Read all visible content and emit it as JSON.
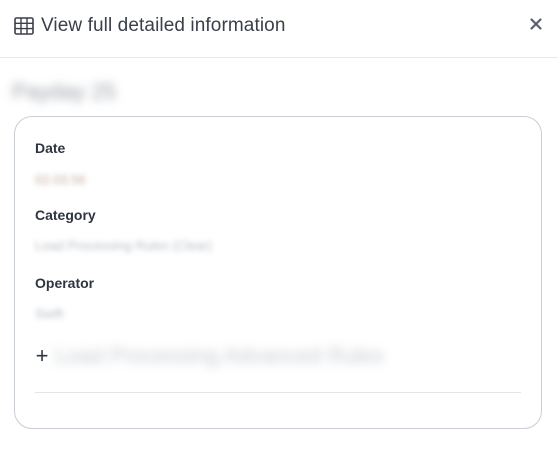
{
  "dialog": {
    "title_icon": "table-grid-icon",
    "title": "View full detailed information",
    "close_icon": "close-icon"
  },
  "record": {
    "name": "Payday 25"
  },
  "fields": {
    "date": {
      "label": "Date",
      "value": "02.03.56"
    },
    "category": {
      "label": "Category",
      "value": "Load Processing Rules (Clear)"
    },
    "operator": {
      "label": "Operator",
      "value": "Swift"
    }
  },
  "expand": {
    "icon": "plus-icon",
    "label": "Load Processing Advanced Rules"
  }
}
